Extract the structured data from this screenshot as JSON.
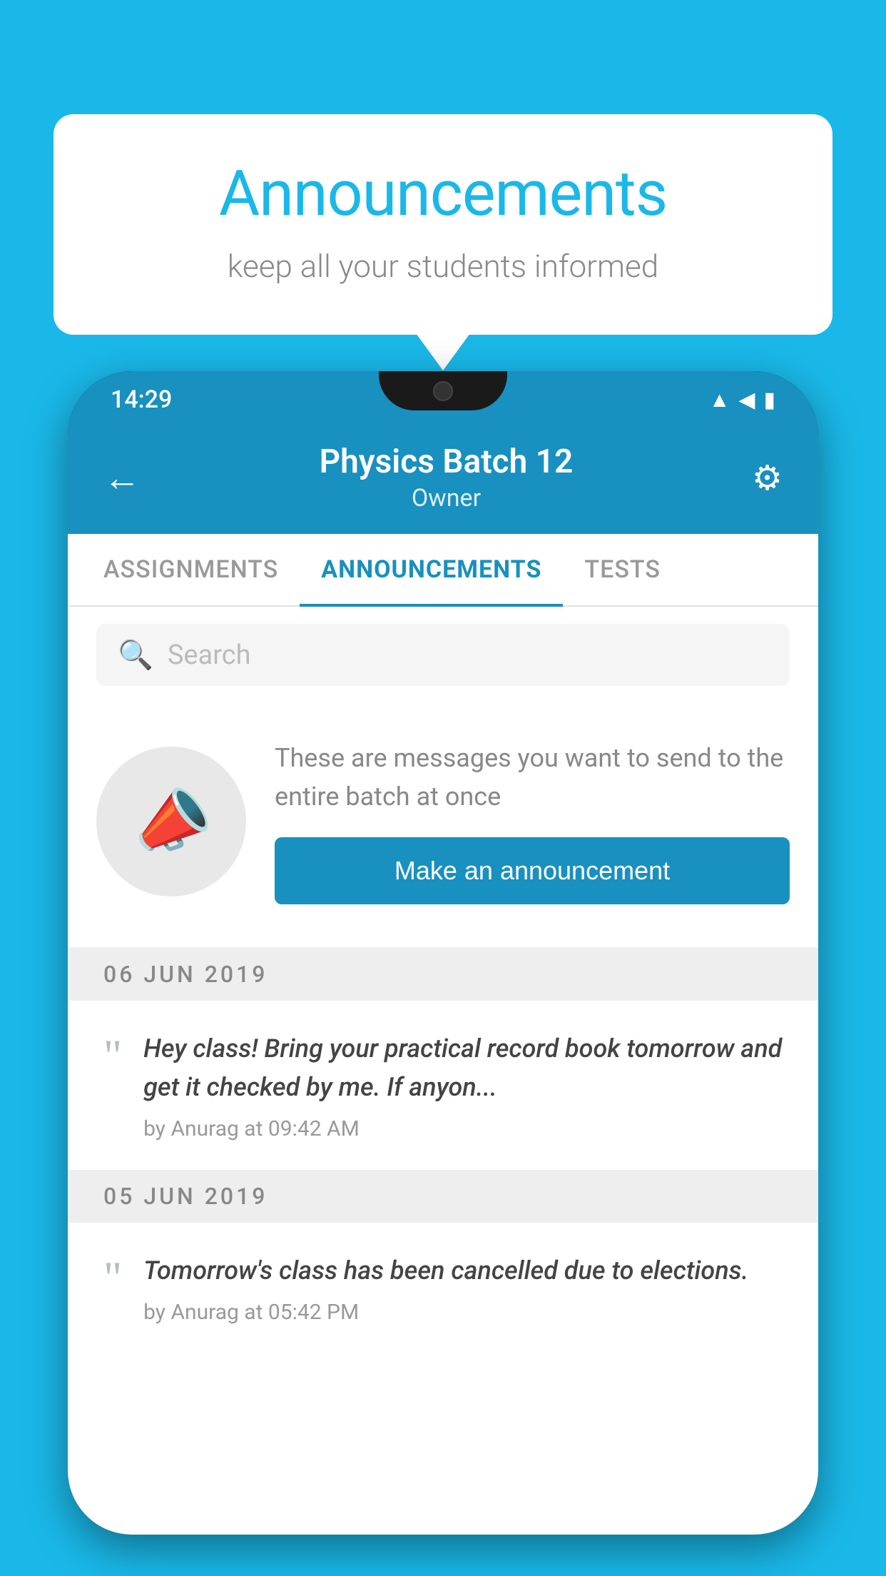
{
  "background_color": "#1ab8e8",
  "speech_bubble": {
    "title": "Announcements",
    "subtitle": "keep all your students informed"
  },
  "phone": {
    "status_bar": {
      "time": "14:29",
      "icons": [
        "wifi",
        "signal",
        "battery"
      ]
    },
    "header": {
      "title": "Physics Batch 12",
      "subtitle": "Owner",
      "back_label": "←",
      "settings_label": "⚙"
    },
    "tabs": [
      {
        "label": "ASSIGNMENTS",
        "active": false
      },
      {
        "label": "ANNOUNCEMENTS",
        "active": true
      },
      {
        "label": "TESTS",
        "active": false
      }
    ],
    "search": {
      "placeholder": "Search"
    },
    "promo": {
      "description": "These are messages you want to send to the entire batch at once",
      "button_label": "Make an announcement"
    },
    "announcements": [
      {
        "date": "06  JUN  2019",
        "text": "Hey class! Bring your practical record book tomorrow and get it checked by me. If anyon...",
        "meta": "by Anurag at 09:42 AM"
      },
      {
        "date": "05  JUN  2019",
        "text": "Tomorrow's class has been cancelled due to elections.",
        "meta": "by Anurag at 05:42 PM"
      }
    ]
  }
}
